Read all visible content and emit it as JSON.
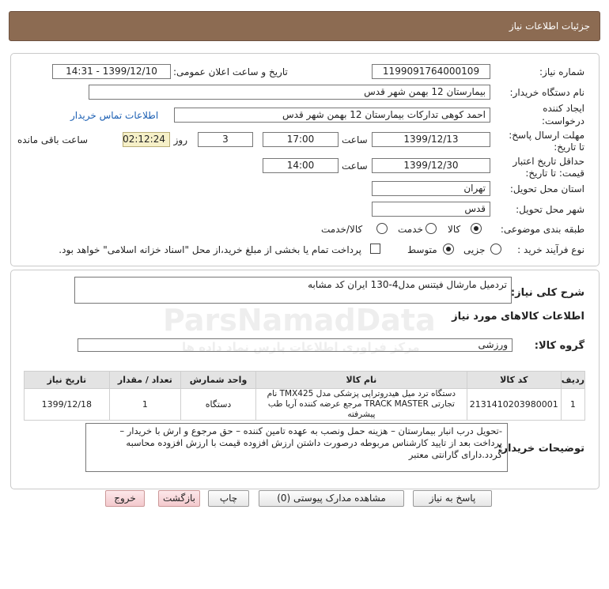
{
  "header": {
    "title": "جزئیات اطلاعات نیاز"
  },
  "form": {
    "need_number_label": "شماره نیاز:",
    "need_number": "1199091764000109",
    "announce_label": "تاریخ و ساعت اعلان عمومی:",
    "announce_value": "1399/12/10 - 14:31",
    "buyer_org_label": "نام دستگاه خریدار:",
    "buyer_org": "بیمارستان 12 بهمن شهر قدس",
    "creator_label_1": "ایجاد کننده",
    "creator_label_2": "درخواست:",
    "creator": "احمد کوهی تدارکات بیمارستان 12 بهمن شهر قدس",
    "contact_link": "اطلاعات تماس خریدار",
    "deadline_label_1": "مهلت ارسال پاسخ:",
    "deadline_label_2": "تا تاریخ:",
    "deadline_date": "1399/12/13",
    "time_label": "ساعت",
    "deadline_time": "17:00",
    "days_value": "3",
    "days_label": "روز و",
    "remaining_time": "02:12:24",
    "remaining_label": "ساعت باقی مانده",
    "validity_label_1": "حداقل تاریخ اعتبار",
    "validity_label_2": "قیمت: تا تاریخ:",
    "validity_date": "1399/12/30",
    "validity_time": "14:00",
    "province_label": "استان محل تحویل:",
    "province": "تهران",
    "city_label": "شهر محل تحویل:",
    "city": "قدس",
    "category_label": "طبقه بندی موضوعی:",
    "category_options": [
      "کالا",
      "خدمت",
      "کالا/خدمت"
    ],
    "process_label": "نوع فرآیند خرید :",
    "process_options": [
      "جزیی",
      "متوسط"
    ],
    "payment_note": "پرداخت تمام یا بخشی از مبلغ خرید،از محل \"اسناد خزانه اسلامی\" خواهد بود."
  },
  "summary": {
    "label": "شرح کلی نیاز:",
    "value": "تردمیل مارشال فیتنس مدل4-130    ایران کد مشابه"
  },
  "goods": {
    "section_title": "اطلاعات کالاهای مورد نیاز",
    "group_label": "گروه کالا:",
    "group_value": "ورزشی",
    "columns": [
      "ردیف",
      "کد کالا",
      "نام کالا",
      "واحد شمارش",
      "تعداد / مقدار",
      "تاریخ نیاز"
    ],
    "rows": [
      {
        "row": "1",
        "code": "2131410203980001",
        "name_line1": "دستگاه ترد میل هیدروتراپی پزشکی مدل TMX425 نام",
        "name_line2": "تجارتی TRACK MASTER مرجع عرضه کننده آریا طب پیشرفته",
        "unit": "دستگاه",
        "qty": "1",
        "date": "1399/12/18"
      }
    ]
  },
  "buyer_notes": {
    "label": "توضیحات خریدار:",
    "text": "-تحویل درب انبار بیمارستان – هزینه حمل ونصب به عهده تامین کننده – حق مرجوع و ارش با خریدار – پرداخت بعد از تایید کارشناس مربوطه درصورت داشتن ارزش افزوده قیمت با ارزش افزوده محاسبه گردد.دارای گارانتی معتبر"
  },
  "buttons": {
    "reply": "پاسخ به نیاز",
    "attachments": "مشاهده مدارک پیوستی (0)",
    "print": "چاپ",
    "back": "بازگشت",
    "exit": "خروج"
  },
  "watermark": {
    "brand": "ParsNamadData",
    "subtitle": "مرکز فراوری اطلاعات پارس نماد داده ها"
  }
}
